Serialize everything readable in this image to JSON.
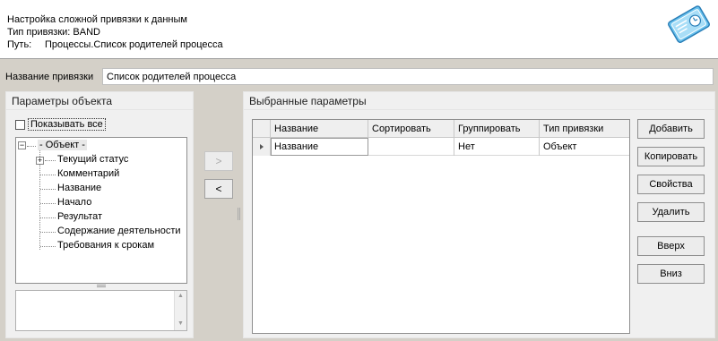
{
  "header": {
    "title": "Настройка сложной привязки к данным",
    "binding_type_line": "Тип привязки: BAND",
    "path_label": "Путь:",
    "path_value": "Процессы.Список родителей процесса"
  },
  "binding_name": {
    "label": "Название привязки",
    "value": "Список родителей процесса"
  },
  "object_params": {
    "title": "Параметры объекта",
    "show_all_label": "Показывать все",
    "show_all_checked": false,
    "tree": {
      "root": "- Объект -",
      "items": [
        "Текущий статус",
        "Комментарий",
        "Название",
        "Начало",
        "Результат",
        "Содержание деятельности",
        "Требования к срокам"
      ]
    }
  },
  "transfer": {
    "add_arrow": ">",
    "remove_arrow": "<"
  },
  "selected_params": {
    "title": "Выбранные параметры",
    "columns": [
      "Название",
      "Сортировать",
      "Группировать",
      "Тип привязки"
    ],
    "rows": [
      {
        "name": "Название",
        "sort": "",
        "group": "Нет",
        "binding_type": "Объект"
      }
    ]
  },
  "buttons": {
    "add": "Добавить",
    "copy": "Копировать",
    "properties": "Свойства",
    "delete": "Удалить",
    "up": "Вверх",
    "down": "Вниз"
  }
}
